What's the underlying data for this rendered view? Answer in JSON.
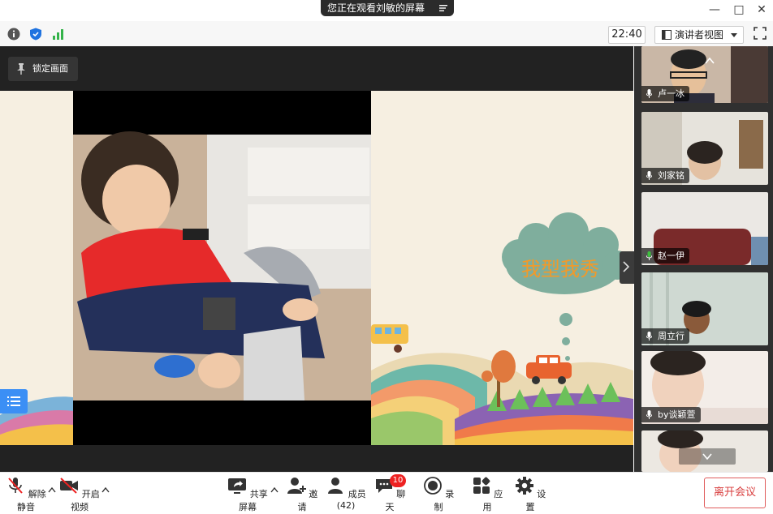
{
  "title_bar": {
    "share_banner": "您正在观看刘敏的屏幕"
  },
  "status": {
    "clock": "22:40",
    "view_mode": "演讲者视图"
  },
  "stage": {
    "lock_tip": "锁定画面",
    "slide_title": "我型我秀"
  },
  "participants": [
    {
      "name": "卢一冰",
      "mic": "on"
    },
    {
      "name": "刘家铭",
      "mic": "on"
    },
    {
      "name": "赵一伊",
      "mic": "active"
    },
    {
      "name": "周立行",
      "mic": "on"
    },
    {
      "name": "by谈颖萱",
      "mic": "on"
    },
    {
      "name": "",
      "mic": "on"
    }
  ],
  "toolbar": {
    "unmute": "解除静音",
    "start_video": "开启视频",
    "share_screen": "共享屏幕",
    "invite": "邀请",
    "participants": "成员(42)",
    "chat": "聊天",
    "chat_badge": "10",
    "record": "录制",
    "apps": "应用",
    "settings": "设置",
    "leave": "离开会议"
  },
  "colors": {
    "accent_blue": "#3b8ff5",
    "leave_red": "#d94040",
    "badge_red": "#e22222",
    "slide_title_orange": "#f19a2a",
    "mic_green": "#3fbf3f"
  },
  "icons": [
    "info-icon",
    "shield-icon",
    "signal-bars-icon",
    "layout-icon",
    "chevron-down-icon",
    "fullscreen-icon",
    "pin-icon",
    "chevron-up-icon",
    "chevron-down-icon",
    "mic-icon",
    "muted-mic-icon",
    "video-off-icon",
    "share-screen-icon",
    "invite-icon",
    "participants-icon",
    "chat-icon",
    "record-icon",
    "apps-icon",
    "gear-icon",
    "list-icon"
  ]
}
